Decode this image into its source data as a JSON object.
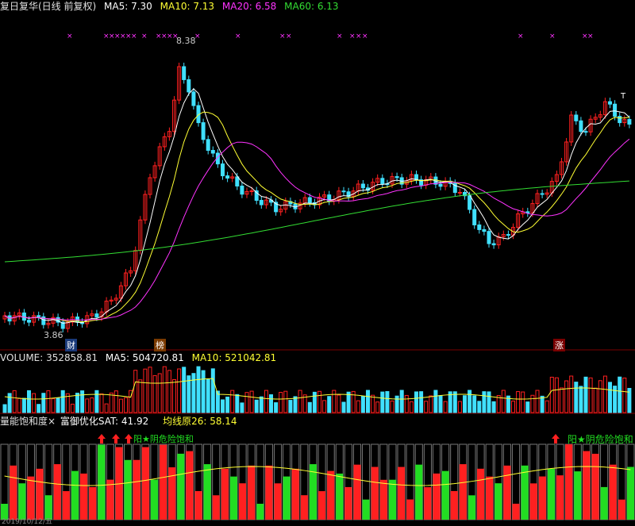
{
  "colors": {
    "up": "#ff2020",
    "down": "#40e0ff",
    "ma5": "#ffffff",
    "ma10": "#ffff33",
    "ma20": "#ff33ff",
    "ma60": "#33dd33",
    "grid": "#7a0000",
    "high_risk": "#ff2020",
    "low_risk": "#22dd22",
    "marker": "#ff33ff"
  },
  "header": {
    "title": "复日复华(日线 前复权)",
    "ma5": "MA5: 7.30",
    "ma10": "MA10: 7.13",
    "ma20": "MA20: 6.58",
    "ma60": "MA60: 6.13"
  },
  "price_panel": {
    "high_label": "8.38",
    "low_label": "3.86",
    "events": [
      {
        "label": "财"
      },
      {
        "label": "榜"
      },
      {
        "label": "涨"
      }
    ],
    "marker_char": "×",
    "top_right_mark": "T"
  },
  "volume_panel": {
    "volume": "VOLUME: 352858.81",
    "ma5": "MA5: 504720.81",
    "ma10": "MA10: 521042.81"
  },
  "indicator_panel": {
    "name": "量能饱和度×",
    "sat": "富御优化SAT: 41.92",
    "base": "均线原26: 58.14",
    "signal_left": "阳★阴危险饱和",
    "signal_right": "阳★阴危险饱和",
    "footer": "2019/10/12/五"
  }
}
